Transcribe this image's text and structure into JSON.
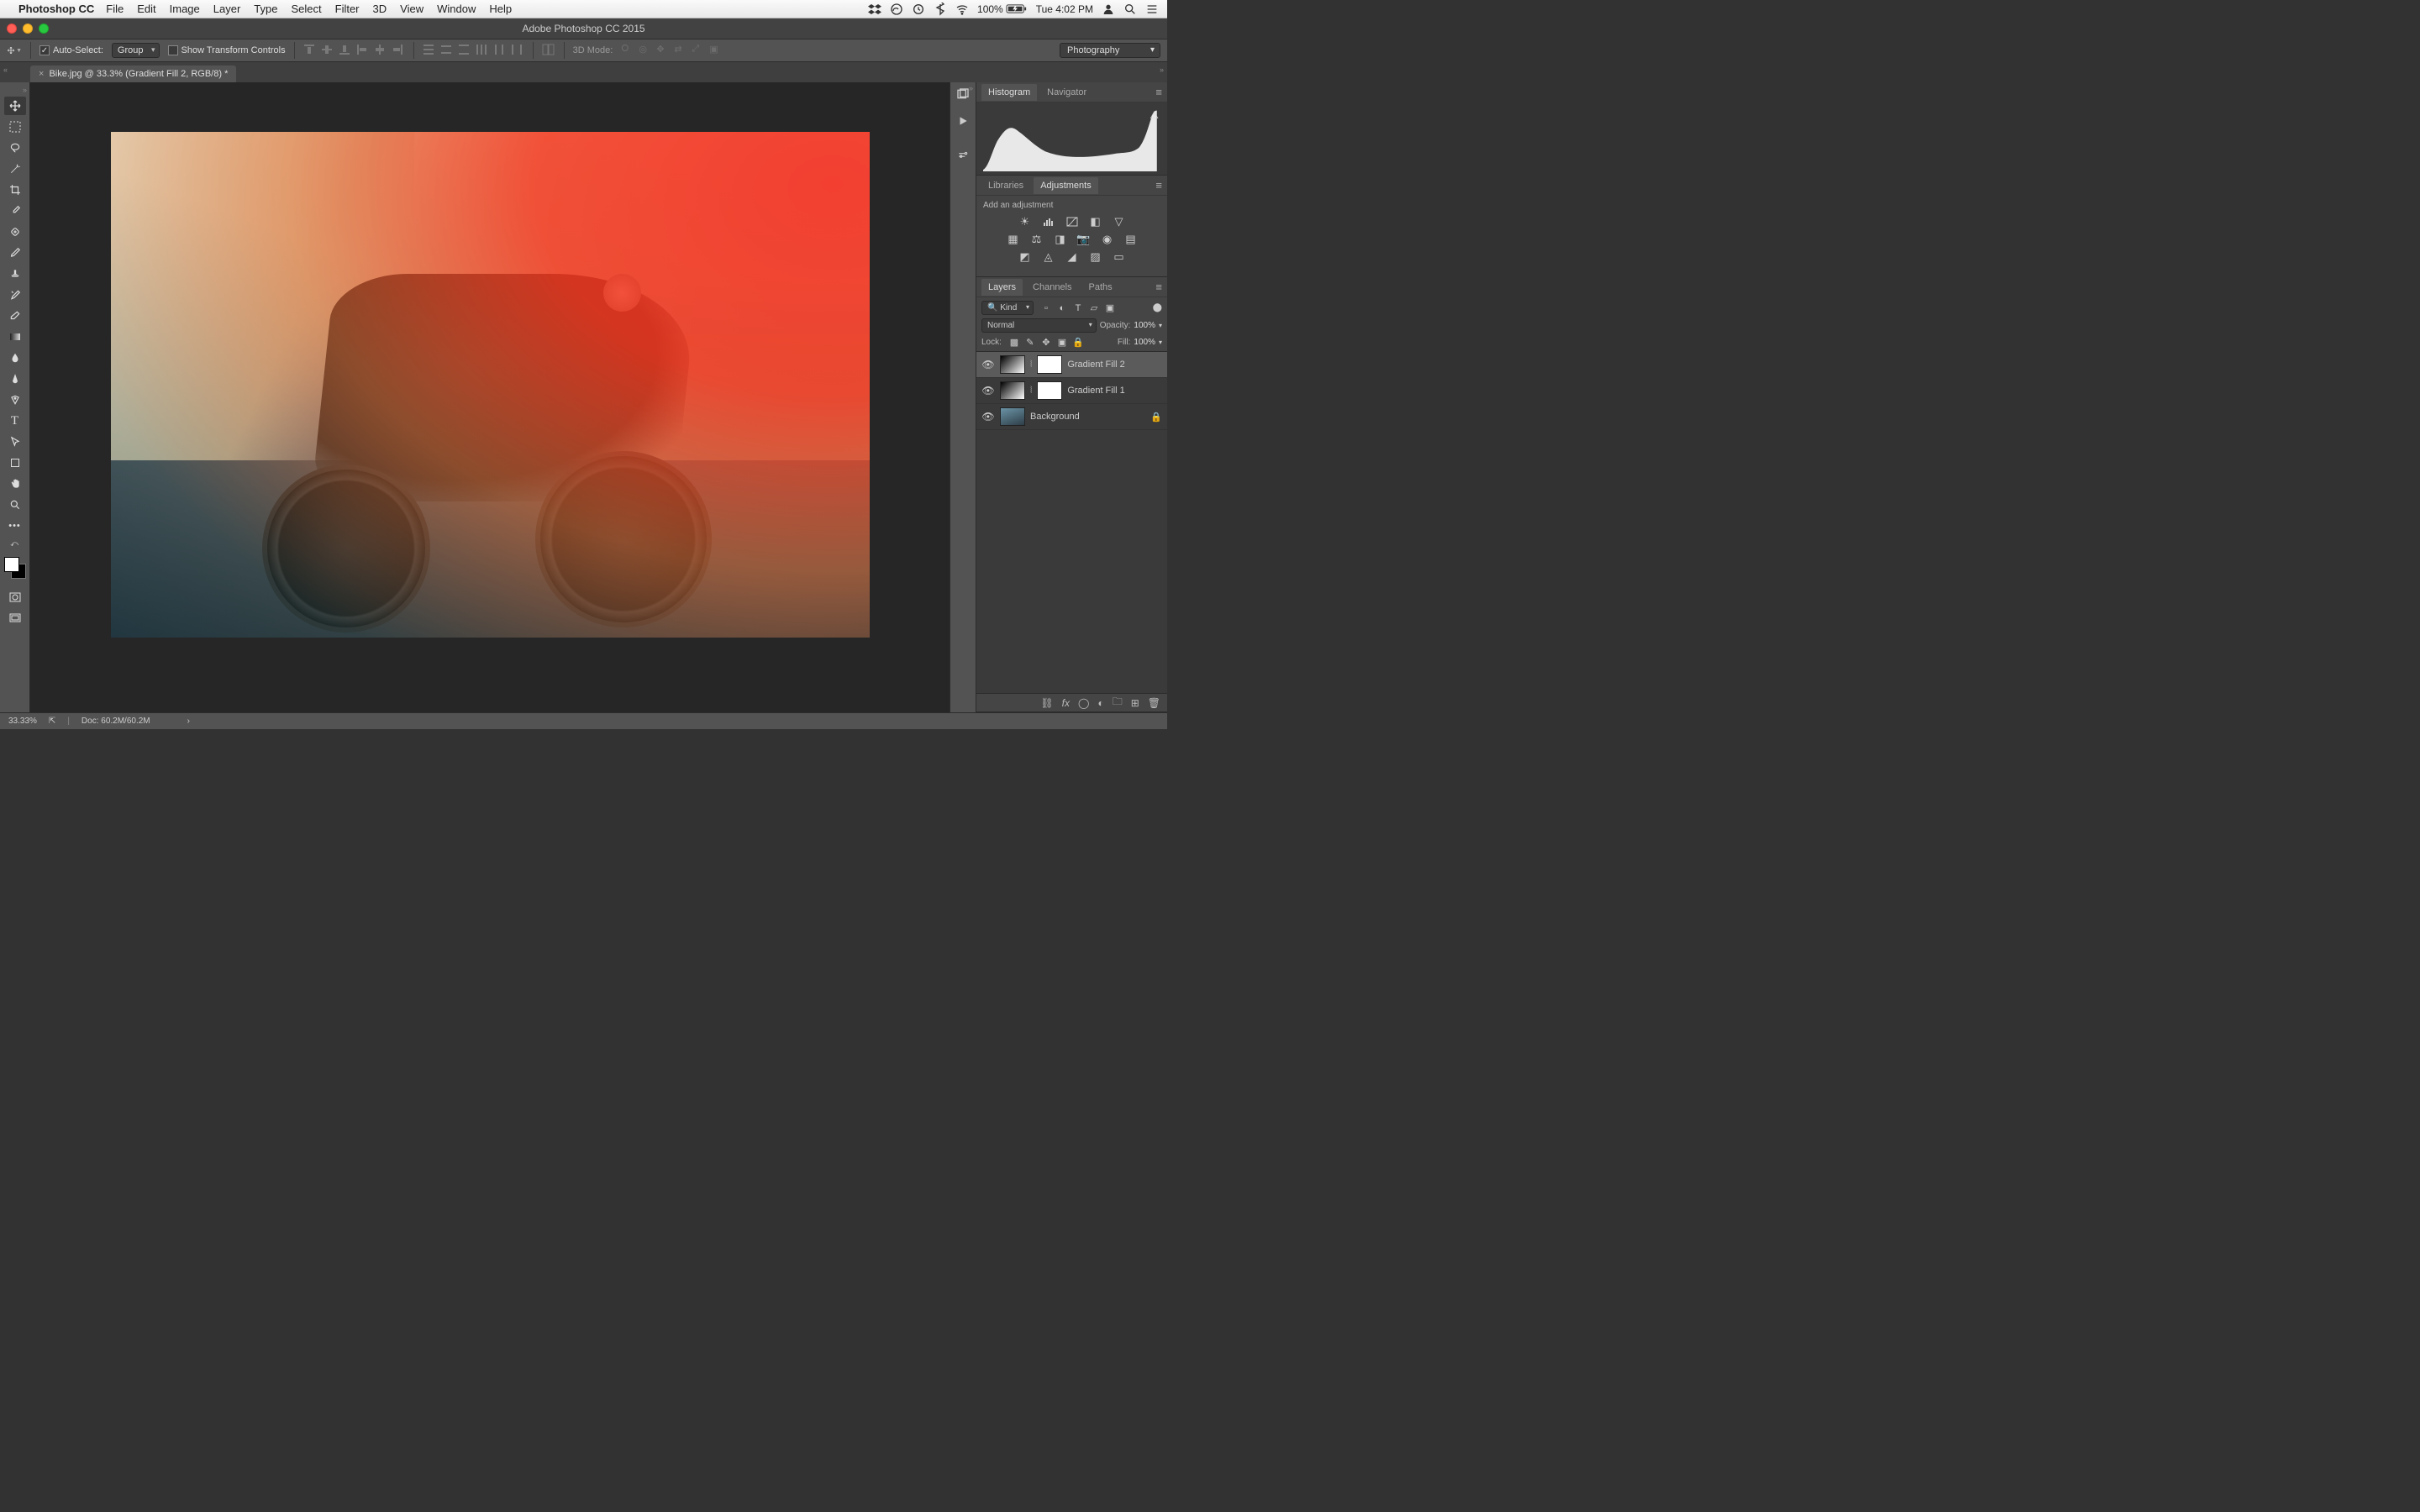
{
  "menubar": {
    "app_name": "Photoshop CC",
    "items": [
      "File",
      "Edit",
      "Image",
      "Layer",
      "Type",
      "Select",
      "Filter",
      "3D",
      "View",
      "Window",
      "Help"
    ],
    "battery": "100%",
    "clock": "Tue 4:02 PM"
  },
  "titlebar": {
    "title": "Adobe Photoshop CC 2015"
  },
  "options": {
    "auto_select_label": "Auto-Select:",
    "auto_select_checked": true,
    "auto_select_value": "Group",
    "show_transform_label": "Show Transform Controls",
    "show_transform_checked": false,
    "mode3d_label": "3D Mode:",
    "workspace": "Photography"
  },
  "document": {
    "tab_label": "Bike.jpg @ 33.3% (Gradient Fill 2, RGB/8) *"
  },
  "panels": {
    "histogram_tab": "Histogram",
    "navigator_tab": "Navigator",
    "libraries_tab": "Libraries",
    "adjustments_tab": "Adjustments",
    "add_adjustment_hint": "Add an adjustment",
    "layers_tab": "Layers",
    "channels_tab": "Channels",
    "paths_tab": "Paths"
  },
  "layers": {
    "kind_label": "Kind",
    "blend_mode": "Normal",
    "opacity_label": "Opacity:",
    "opacity_value": "100%",
    "lock_label": "Lock:",
    "fill_label": "Fill:",
    "fill_value": "100%",
    "items": [
      {
        "name": "Gradient Fill 2",
        "locked": false,
        "type": "gradient",
        "selected": true
      },
      {
        "name": "Gradient Fill 1",
        "locked": false,
        "type": "gradient",
        "selected": false
      },
      {
        "name": "Background",
        "locked": true,
        "type": "photo",
        "selected": false
      }
    ]
  },
  "status": {
    "zoom": "33.33%",
    "doc_label": "Doc: 60.2M/60.2M"
  }
}
